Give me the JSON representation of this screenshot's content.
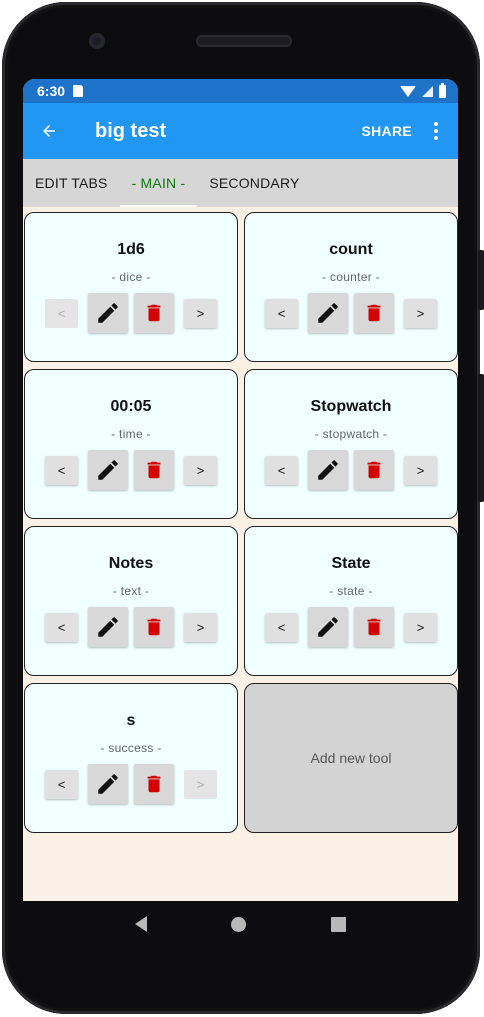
{
  "status": {
    "time": "6:30"
  },
  "appbar": {
    "title": "big test",
    "share_label": "SHARE"
  },
  "tabs": [
    {
      "label": "EDIT TABS"
    },
    {
      "label": "- MAIN -"
    },
    {
      "label": "SECONDARY"
    }
  ],
  "colors": {
    "appbar": "#2196f3",
    "statusbar": "#1e72c8",
    "active_tab": "#0b7a0b",
    "card_bg": "#f0ffff",
    "delete": "#d50000"
  },
  "tools": [
    {
      "name": "1d6",
      "type": "- dice -",
      "prev": "<",
      "next": ">"
    },
    {
      "name": "count",
      "type": "- counter -",
      "prev": "<",
      "next": ">"
    },
    {
      "name": "00:05",
      "type": "- time -",
      "prev": "<",
      "next": ">"
    },
    {
      "name": "Stopwatch",
      "type": "- stopwatch -",
      "prev": "<",
      "next": ">"
    },
    {
      "name": "Notes",
      "type": "- text -",
      "prev": "<",
      "next": ">"
    },
    {
      "name": "State",
      "type": "- state -",
      "prev": "<",
      "next": ">"
    },
    {
      "name": "s",
      "type": "- success -",
      "prev": "<",
      "next": ">"
    }
  ],
  "add_tool_label": "Add new tool"
}
